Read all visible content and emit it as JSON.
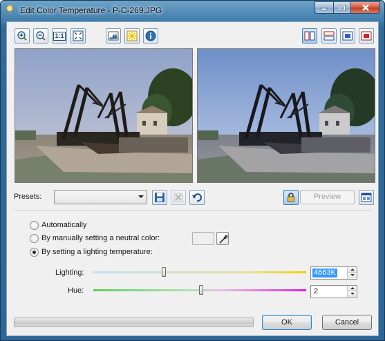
{
  "window": {
    "title": "Edit Color Temperature - P-C-269.JPG"
  },
  "toolbar": {
    "zoom_one_label": "1:1",
    "tools": [
      "zoom-in-icon",
      "zoom-out-icon",
      "actual-size-icon",
      "fit-to-window-icon",
      "histogram-icon",
      "highlight-icon",
      "info-icon"
    ],
    "layouts": [
      "split-vertical-icon",
      "split-horizontal-icon",
      "single-before-icon",
      "single-after-icon"
    ]
  },
  "presets": {
    "label": "Presets:",
    "value": ""
  },
  "preview_button": "Preview",
  "options": {
    "automatically": "Automatically",
    "neutral": "By manually setting a neutral color:",
    "temperature": "By setting a lighting temperature:",
    "selected": "temperature"
  },
  "lighting": {
    "label": "Lighting:",
    "value": "4663K",
    "position": 0.33
  },
  "hue": {
    "label": "Hue:",
    "value": "2",
    "position": 0.51
  },
  "buttons": {
    "ok": "OK",
    "cancel": "Cancel"
  },
  "colors": {
    "titlebar": "#3f7bab",
    "accent": "#3c7fb1",
    "selection": "#3399ff"
  }
}
